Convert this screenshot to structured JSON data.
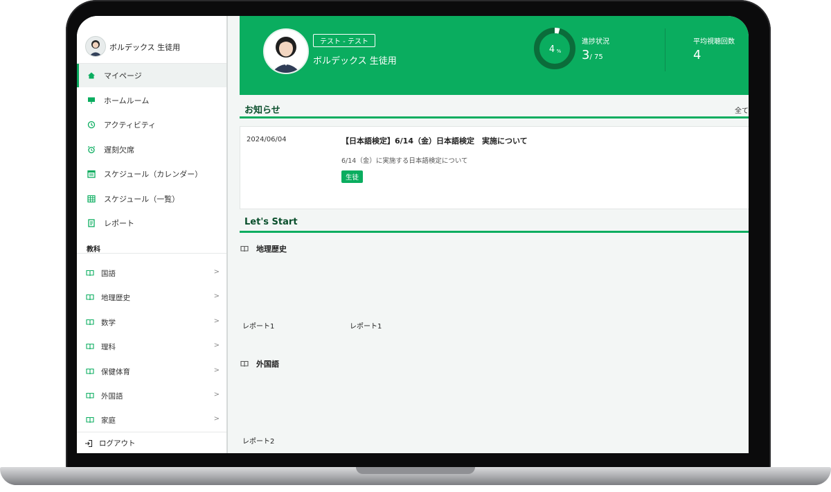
{
  "user": {
    "name": "ボルデックス 生徒用"
  },
  "nav": [
    {
      "label": "マイページ"
    },
    {
      "label": "ホームルーム"
    },
    {
      "label": "アクティビティ"
    },
    {
      "label": "遅刻欠席"
    },
    {
      "label": "スケジュール（カレンダー）"
    },
    {
      "label": "スケジュール（一覧）"
    },
    {
      "label": "レポート"
    }
  ],
  "subjects_label": "教科",
  "subjects": [
    {
      "label": "国語"
    },
    {
      "label": "地理歴史"
    },
    {
      "label": "数学"
    },
    {
      "label": "理科"
    },
    {
      "label": "保健体育"
    },
    {
      "label": "外国語"
    },
    {
      "label": "家庭"
    }
  ],
  "logout_label": "ログアウト",
  "hero": {
    "class_tag": "テスト - テスト",
    "name": "ボルデックス 生徒用",
    "progress_percent": "4",
    "percent_sign": "%",
    "progress_fraction": 0.04,
    "progress_label": "進捗状況",
    "progress_done": "3",
    "progress_total": "/ 75",
    "avg_label": "平均視聴回数",
    "avg_value": "4"
  },
  "news": {
    "title": "お知らせ",
    "more": "全て",
    "items": [
      {
        "date": "2024/06/04",
        "title": "【日本語検定】6/14（金）日本語検定　実施について",
        "desc": "6/14（金）に実施する日本語検定について",
        "badge": "生徒"
      }
    ]
  },
  "start": {
    "title": "Let's Start",
    "subjects": [
      {
        "label": "地理歴史",
        "reports": [
          "レポート1",
          "レポート1"
        ]
      },
      {
        "label": "外国語",
        "reports": [
          "レポート2"
        ]
      }
    ]
  },
  "colors": {
    "accent": "#0aad5f",
    "dark_green": "#0a4f2c"
  }
}
